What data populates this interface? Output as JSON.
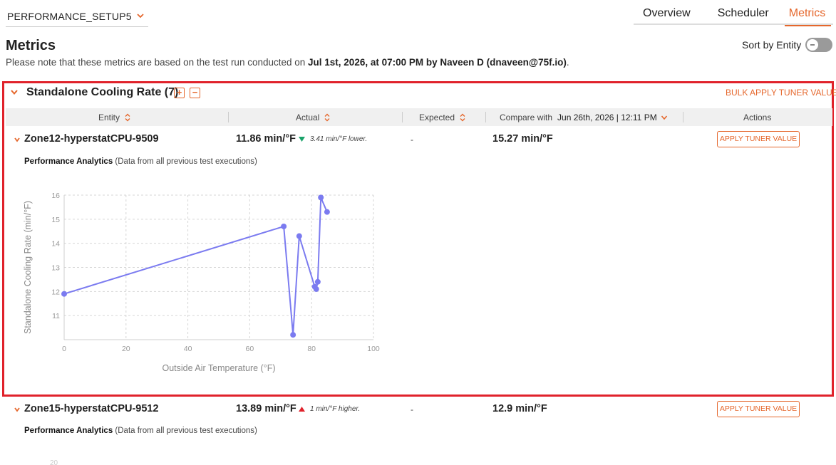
{
  "header": {
    "setup_select": "PERFORMANCE_SETUP5",
    "tabs": [
      "Overview",
      "Scheduler",
      "Metrics"
    ],
    "active_tab": "Metrics",
    "accent_color": "#e5672c"
  },
  "page": {
    "title": "Metrics",
    "note_prefix": "Please note that these metrics are based on the test run conducted on ",
    "note_date": "Jul 1st, 2026, at 07:00 PM by Naveen D (dnaveen@75f.io)",
    "note_suffix": ".",
    "sort_label": "Sort by Entity",
    "sort_enabled": false
  },
  "group": {
    "title": "Standalone Cooling Rate (7)",
    "expand_icon": "plus-icon",
    "collapse_icon": "minus-icon",
    "bulk_apply_label": "BULK APPLY TUNER VALUE"
  },
  "table": {
    "headers": {
      "entity": "Entity",
      "actual": "Actual",
      "expected": "Expected",
      "compare_with": "Compare with",
      "compare_date": "Jun 26th, 2026 | 12:11 PM",
      "actions": "Actions"
    },
    "rows": [
      {
        "entity": "Zone12-hyperstatCPU-9509",
        "actual": "11.86 min/°F",
        "delta": "3.41 min/°F lower.",
        "trend": "down",
        "expected": "-",
        "compare": "15.27 min/°F",
        "action": "APPLY TUNER VALUE",
        "analytics_title": "Performance Analytics",
        "analytics_note": "(Data from all previous test executions)"
      },
      {
        "entity": "Zone15-hyperstatCPU-9512",
        "actual": "13.89 min/°F",
        "delta": "1 min/°F higher.",
        "trend": "up",
        "expected": "-",
        "compare": "12.9 min/°F",
        "action": "APPLY TUNER VALUE",
        "analytics_title": "Performance Analytics",
        "analytics_note": "(Data from all previous test executions)"
      }
    ]
  },
  "chart_data": {
    "type": "line",
    "xlabel": "Outside Air Temperature (°F)",
    "ylabel": "Standalone Cooling Rate (min/°F)",
    "xlim": [
      0,
      100
    ],
    "ylim": [
      10,
      16
    ],
    "xticks": [
      0,
      20,
      40,
      60,
      80,
      100
    ],
    "yticks": [
      11,
      12,
      13,
      14,
      15,
      16
    ],
    "grid": true,
    "line_color": "#7b7bf0",
    "x": [
      0,
      71,
      74,
      76,
      81,
      81.5,
      82,
      83,
      85
    ],
    "y": [
      11.9,
      14.7,
      10.2,
      14.3,
      12.2,
      12.1,
      12.4,
      15.9,
      15.3
    ]
  },
  "second_chart_partial_tick": "20"
}
